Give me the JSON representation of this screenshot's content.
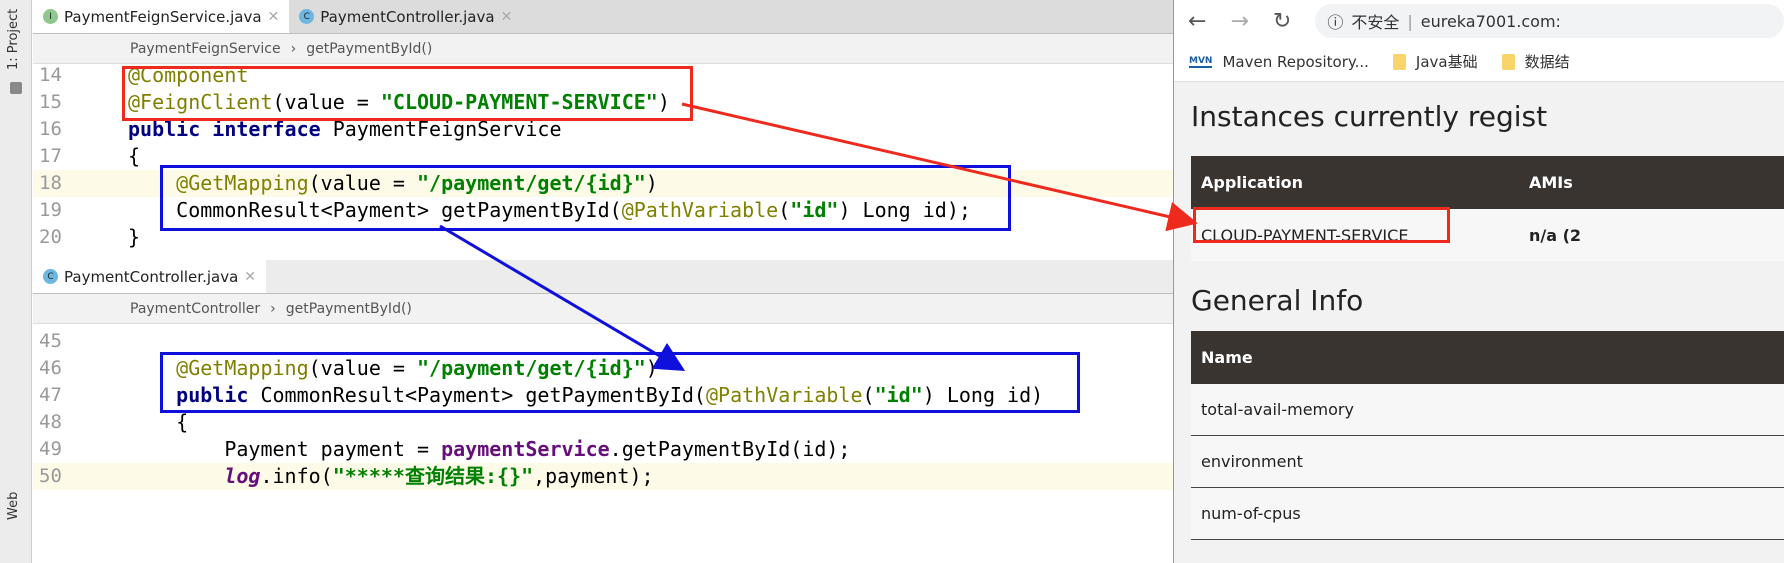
{
  "side": {
    "project": "1: Project",
    "web": "Web"
  },
  "top": {
    "tabs": [
      {
        "label": "PaymentFeignService.java",
        "icon": "I",
        "color": "#8dc98d"
      },
      {
        "label": "PaymentController.java",
        "icon": "C",
        "color": "#6cb6e0"
      }
    ],
    "crumbs": [
      "PaymentFeignService",
      "getPaymentById()"
    ],
    "lines": [
      {
        "n": "14",
        "t": [
          [
            "@Component",
            "ann"
          ]
        ]
      },
      {
        "n": "15",
        "t": [
          [
            "@FeignClient",
            "ann"
          ],
          [
            "(value = ",
            "pl"
          ],
          [
            "\"CLOUD-PAYMENT-SERVICE\"",
            "str"
          ],
          [
            ")",
            "pl"
          ]
        ]
      },
      {
        "n": "16",
        "t": [
          [
            "public interface ",
            "kw"
          ],
          [
            "PaymentFeignService",
            "pl"
          ]
        ]
      },
      {
        "n": "17",
        "t": [
          [
            "{",
            "pl"
          ]
        ]
      },
      {
        "n": "18",
        "hl": true,
        "t": [
          [
            "    @GetMapping",
            "ann"
          ],
          [
            "(value = ",
            "pl"
          ],
          [
            "\"/payment/get/{id}\"",
            "str"
          ],
          [
            ")",
            "pl"
          ]
        ]
      },
      {
        "n": "19",
        "t": [
          [
            "    CommonResult<Payment> getPaymentById(",
            "pl"
          ],
          [
            "@PathVariable",
            "ann"
          ],
          [
            "(",
            "pl"
          ],
          [
            "\"id\"",
            "str"
          ],
          [
            ") Long id);",
            "pl"
          ]
        ]
      },
      {
        "n": "20",
        "t": [
          [
            "}",
            "pl"
          ]
        ]
      }
    ]
  },
  "bottom": {
    "tab": {
      "label": "PaymentController.java",
      "icon": "C",
      "color": "#6cb6e0"
    },
    "crumbs": [
      "PaymentController",
      "getPaymentById()"
    ],
    "lines": [
      {
        "n": "45",
        "t": [
          [
            "",
            "pl"
          ]
        ]
      },
      {
        "n": "46",
        "t": [
          [
            "    @GetMapping",
            "ann"
          ],
          [
            "(value = ",
            "pl"
          ],
          [
            "\"/payment/get/{id}\"",
            "str"
          ],
          [
            ")",
            "pl"
          ]
        ]
      },
      {
        "n": "47",
        "t": [
          [
            "    public ",
            "kw"
          ],
          [
            "CommonResult<Payment> getPaymentById(",
            "pl"
          ],
          [
            "@PathVariable",
            "ann"
          ],
          [
            "(",
            "pl"
          ],
          [
            "\"id\"",
            "str"
          ],
          [
            ") Long id)",
            "pl"
          ]
        ]
      },
      {
        "n": "48",
        "t": [
          [
            "    {",
            "pl"
          ]
        ]
      },
      {
        "n": "49",
        "t": [
          [
            "        Payment payment = ",
            "pl"
          ],
          [
            "paymentService",
            "fld"
          ],
          [
            ".getPaymentById(id);",
            "pl"
          ]
        ]
      },
      {
        "n": "50",
        "hl": true,
        "t": [
          [
            "        ",
            "pl"
          ],
          [
            "log",
            "st"
          ],
          [
            ".info(",
            "pl"
          ],
          [
            "\"*****查询结果:{}\"",
            "str"
          ],
          [
            ",payment);",
            "pl"
          ]
        ]
      }
    ]
  },
  "browser": {
    "security": "不安全",
    "url": "eureka7001.com:",
    "bookmarks": [
      "Maven Repository...",
      "Java基础",
      "数据结"
    ],
    "instances_title": "Instances currently regist",
    "app_header": "Application",
    "amis_header": "AMIs",
    "app_name": "CLOUD-PAYMENT-SERVICE",
    "amis_value": "n/a (2",
    "general_title": "General Info",
    "name_header": "Name",
    "rows": [
      "total-avail-memory",
      "environment",
      "num-of-cpus"
    ]
  },
  "colors": {
    "red": "#ee2a1e",
    "blue": "#1010dd"
  }
}
